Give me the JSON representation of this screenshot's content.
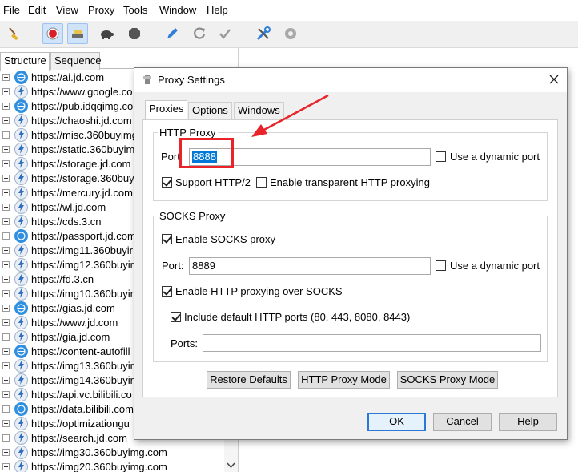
{
  "menu": [
    "File",
    "Edit",
    "View",
    "Proxy",
    "Tools",
    "Window",
    "Help"
  ],
  "left_tabs": [
    "Structure",
    "Sequence"
  ],
  "sessions": [
    "https://ai.jd.com",
    "https://www.google.co",
    "https://pub.idqqimg.co",
    "https://chaoshi.jd.com",
    "https://misc.360buyimg",
    "https://static.360buyim",
    "https://storage.jd.com",
    "https://storage.360buy",
    "https://mercury.jd.com",
    "https://wl.jd.com",
    "https://cds.3.cn",
    "https://passport.jd.com",
    "https://img11.360buyir",
    "https://img12.360buyir",
    "https://fd.3.cn",
    "https://img10.360buyir",
    "https://gias.jd.com",
    "https://www.jd.com",
    "https://gia.jd.com",
    "https://content-autofill",
    "https://img13.360buyir",
    "https://img14.360buyir",
    "https://api.vc.bilibili.co",
    "https://data.bilibili.com",
    "https://optimizationgu",
    "https://search.jd.com",
    "https://img30.360buyimg.com",
    "https://img20.360buyimg.com"
  ],
  "session_icons": [
    "blue",
    "lightning",
    "blue",
    "lightning",
    "lightning",
    "lightning",
    "lightning",
    "lightning",
    "lightning",
    "lightning",
    "lightning",
    "blue",
    "lightning",
    "lightning",
    "lightning",
    "lightning",
    "blue",
    "lightning",
    "lightning",
    "blue",
    "lightning",
    "lightning",
    "lightning",
    "blue",
    "lightning",
    "lightning",
    "lightning",
    "lightning"
  ],
  "dialog": {
    "title": "Proxy Settings",
    "tabs": [
      "Proxies",
      "Options",
      "Windows"
    ],
    "http_group_title": "HTTP Proxy",
    "http_port_label": "Port",
    "http_port_value": "8888",
    "http_dynamic_label": "Use a dynamic port",
    "support_http2_label": "Support HTTP/2",
    "transparent_label": "Enable transparent HTTP proxying",
    "socks_group_title": "SOCKS Proxy",
    "enable_socks_label": "Enable SOCKS proxy",
    "socks_port_label": "Port:",
    "socks_port_value": "8889",
    "socks_dynamic_label": "Use a dynamic port",
    "http_over_socks_label": "Enable HTTP proxying over SOCKS",
    "include_ports_label": "Include default HTTP ports (80, 443, 8080, 8443)",
    "ports_label": "Ports:",
    "ports_value": "",
    "restore_label": "Restore Defaults",
    "http_mode_label": "HTTP Proxy Mode",
    "socks_mode_label": "SOCKS Proxy Mode",
    "ok_label": "OK",
    "cancel_label": "Cancel",
    "help_label": "Help"
  },
  "colors": {
    "annotation": "#e8232a",
    "accent": "#2b78d6",
    "selection": "#0078d7"
  }
}
